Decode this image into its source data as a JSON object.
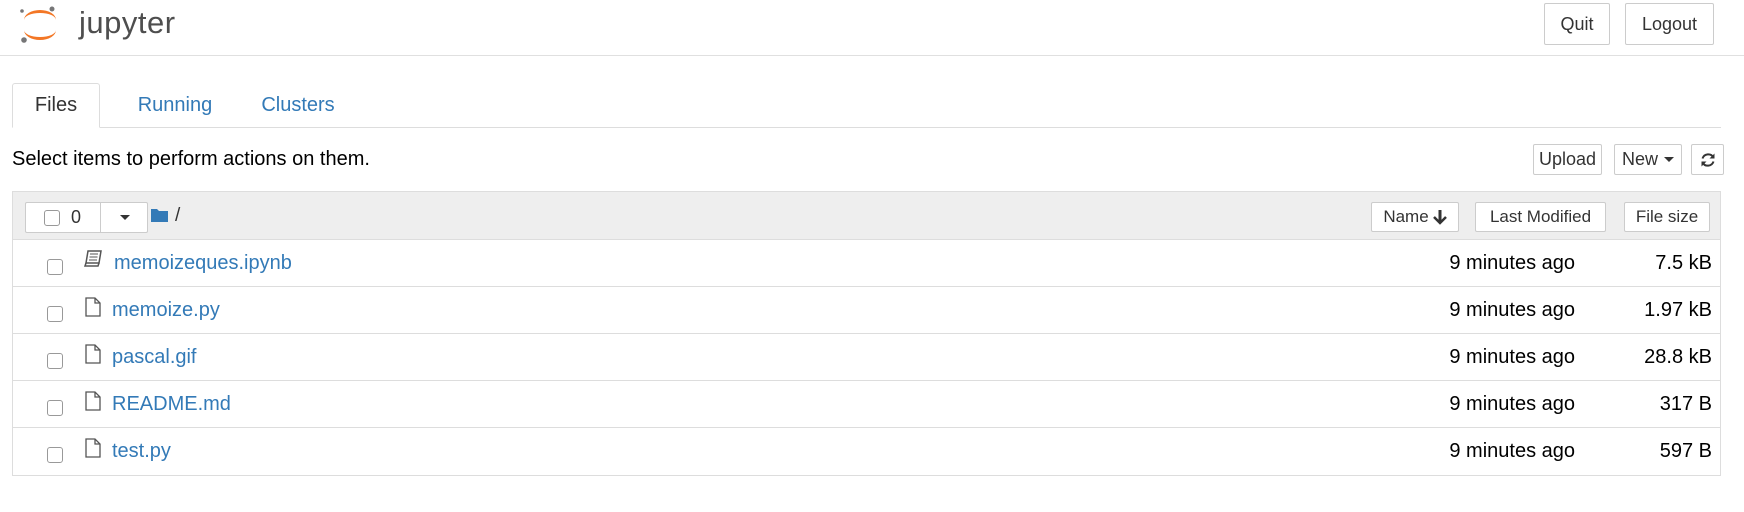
{
  "header": {
    "logo_text": "jupyter",
    "quit_label": "Quit",
    "logout_label": "Logout"
  },
  "tabs": [
    {
      "label": "Files",
      "active": true
    },
    {
      "label": "Running",
      "active": false
    },
    {
      "label": "Clusters",
      "active": false
    }
  ],
  "toolbar": {
    "info_text": "Select items to perform actions on them.",
    "upload_label": "Upload",
    "new_label": "New",
    "refresh_icon": "refresh-icon"
  },
  "list_header": {
    "selected_count": "0",
    "breadcrumb_root": "/",
    "sort_name_label": "Name",
    "sort_modified_label": "Last Modified",
    "sort_size_label": "File size"
  },
  "files": [
    {
      "name": "memoizeques.ipynb",
      "icon": "notebook-icon",
      "modified": "9 minutes ago",
      "size": "7.5 kB"
    },
    {
      "name": "memoize.py",
      "icon": "file-icon",
      "modified": "9 minutes ago",
      "size": "1.97 kB"
    },
    {
      "name": "pascal.gif",
      "icon": "file-icon",
      "modified": "9 minutes ago",
      "size": "28.8 kB"
    },
    {
      "name": "README.md",
      "icon": "file-icon",
      "modified": "9 minutes ago",
      "size": "317 B"
    },
    {
      "name": "test.py",
      "icon": "file-icon",
      "modified": "9 minutes ago",
      "size": "597 B"
    }
  ],
  "colors": {
    "link": "#337ab7",
    "logo_orange": "#F37726",
    "logo_gray": "#767677",
    "header_bg": "#eeeeee"
  }
}
